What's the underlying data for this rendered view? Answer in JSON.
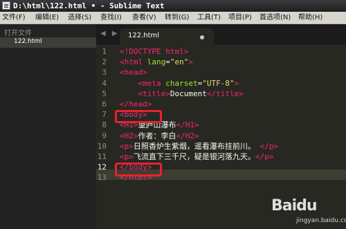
{
  "window": {
    "title": "D:\\html\\122.html • - Sublime Text"
  },
  "menu": [
    "文件(F)",
    "编辑(E)",
    "选择(S)",
    "查找(I)",
    "查看(V)",
    "转到(G)",
    "工具(T)",
    "项目(P)",
    "首选项(N)",
    "帮助(H)"
  ],
  "sidebar": {
    "header": "打开文件",
    "files": [
      "122.html"
    ]
  },
  "tabs": [
    {
      "label": "122.html"
    }
  ],
  "nav": {
    "arrows": "◀ ▶"
  },
  "editor": {
    "line_numbers": [
      "1",
      "2",
      "3",
      "4",
      "5",
      "6",
      "7",
      "8",
      "9",
      "10",
      "11",
      "12",
      "13"
    ],
    "current_line": 12,
    "highlighted_lines": [
      7,
      12
    ],
    "lines": [
      [
        [
          "tag",
          "<!DOCTYPE html>"
        ]
      ],
      [
        [
          "tag",
          "<html "
        ],
        [
          "attr",
          "lang"
        ],
        [
          "txt",
          "="
        ],
        [
          "str",
          "\"en\""
        ],
        [
          "tag",
          ">"
        ]
      ],
      [
        [
          "tag",
          "<head>"
        ]
      ],
      [
        [
          "txt",
          "    "
        ],
        [
          "tag",
          "<meta "
        ],
        [
          "attr",
          "charset"
        ],
        [
          "txt",
          "="
        ],
        [
          "str",
          "\"UTF-8\""
        ],
        [
          "tag",
          ">"
        ]
      ],
      [
        [
          "txt",
          "    "
        ],
        [
          "tag",
          "<title>"
        ],
        [
          "txt",
          "Document"
        ],
        [
          "tag",
          "</title>"
        ]
      ],
      [
        [
          "tag",
          "</head>"
        ]
      ],
      [
        [
          "tag",
          "<body>"
        ]
      ],
      [
        [
          "tag",
          "<H1>"
        ],
        [
          "txt",
          "望庐山瀑布"
        ],
        [
          "tag",
          "</H1>"
        ]
      ],
      [
        [
          "tag",
          "<H2>"
        ],
        [
          "txt",
          "作者：李白"
        ],
        [
          "tag",
          "</H2>"
        ]
      ],
      [
        [
          "tag",
          "<p>"
        ],
        [
          "txt",
          "日照香炉生紫烟，遥看瀑布挂前川。 "
        ],
        [
          "tag",
          "</p>"
        ]
      ],
      [
        [
          "tag",
          "<p>"
        ],
        [
          "txt",
          "飞流直下三千尺，疑是银河落九天。"
        ],
        [
          "tag",
          "</p>"
        ]
      ],
      [
        [
          "tag",
          "</body>"
        ]
      ],
      [
        [
          "tag",
          "</html>"
        ]
      ]
    ]
  },
  "watermark": {
    "brand": "Baidu",
    "sub": "jingyan.baidu.com"
  },
  "colors": {
    "background": "#272822",
    "tag": "#f92672",
    "attribute": "#a6e22e",
    "string": "#e6db74",
    "highlight": "#e8222f"
  }
}
